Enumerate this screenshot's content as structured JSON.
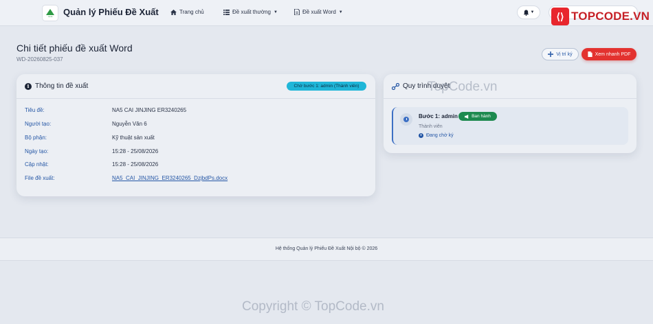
{
  "navbar": {
    "brand_title": "Quản lý Phiếu Đề Xuất",
    "logo_text": "nova",
    "home_label": "Trang chủ",
    "standard_menu_label": "Đề xuất thường",
    "word_menu_label": "Đề xuất Word"
  },
  "watermark": {
    "logo_text": "TOPCODE.VN",
    "center_text": "TopCode.vn",
    "bottom_text": "Copyright © TopCode.vn"
  },
  "page": {
    "title": "Chi tiết phiếu đề xuất Word",
    "code": "WD-20260825-037",
    "sign_position_label": "Vị trí ký",
    "quick_pdf_label": "Xem nhanh PDF"
  },
  "info_card": {
    "title": "Thông tin đề xuất",
    "status": "Chờ bước 1: admin (Thành viên)",
    "rows": [
      {
        "label": "Tiêu đề:",
        "value": "NA5 CAI JINJING ER3240265"
      },
      {
        "label": "Người tạo:",
        "value": "Nguyễn Văn 6"
      },
      {
        "label": "Bộ phận:",
        "value": "Kỹ thuật sản xuất"
      },
      {
        "label": "Ngày tạo:",
        "value": "15:28 - 25/08/2026"
      },
      {
        "label": "Cập nhật:",
        "value": "15:28 - 25/08/2026"
      },
      {
        "label": "File đề xuất:",
        "value": "NA5_CAI_JINJING_ER3240265_DzjbdPs.docx"
      }
    ]
  },
  "flow_card": {
    "title": "Quy trình duyệt",
    "step": {
      "title": "Bước 1: admin",
      "badge": "Ban hành",
      "role": "Thành viên",
      "status": "Đang chờ ký"
    }
  },
  "footer": {
    "text": "Hệ thống Quản lý Phiếu Đề Xuất Nội bộ © 2026"
  },
  "colors": {
    "accent": "#2456a5",
    "danger": "#e3322f",
    "info": "#1fb6d8",
    "success": "#1d8a4f"
  },
  "icons": [
    "home-icon",
    "list-icon",
    "file-word-icon",
    "bell-icon",
    "plus-cross-icon",
    "pdf-icon",
    "info-icon",
    "flow-icon",
    "clock-icon",
    "megaphone-icon"
  ]
}
